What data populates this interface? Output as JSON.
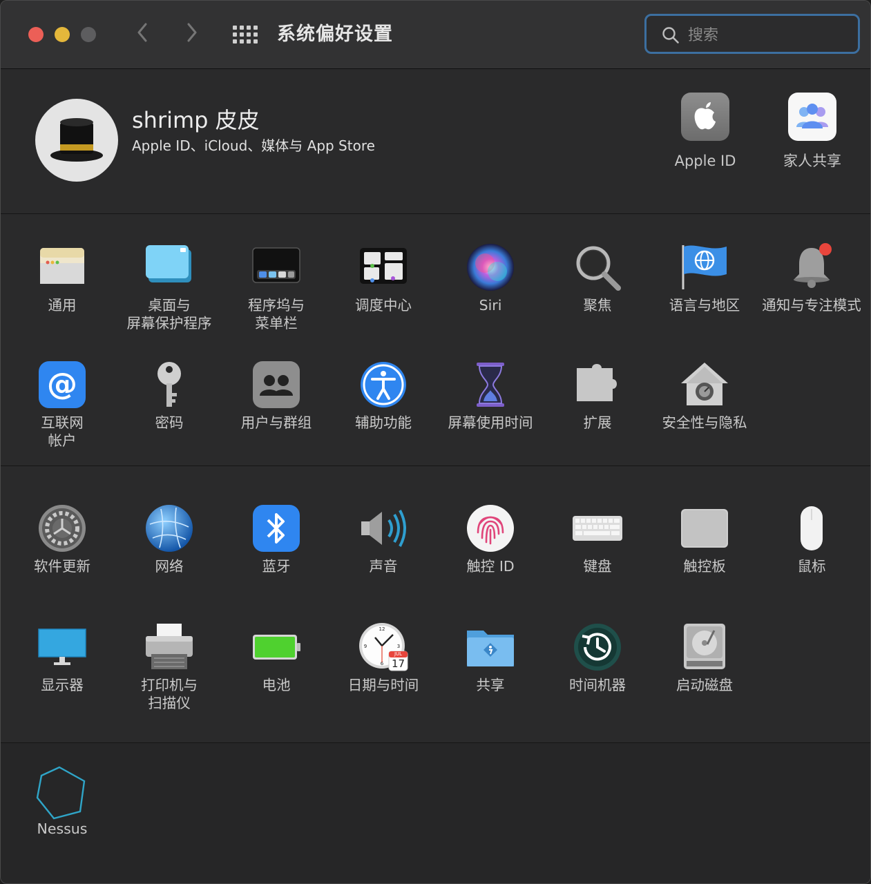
{
  "window": {
    "title": "系统偏好设置"
  },
  "search": {
    "placeholder": "搜索"
  },
  "account": {
    "name": "shrimp 皮皮",
    "subtitle": "Apple ID、iCloud、媒体与 App Store",
    "apple_id_label": "Apple ID",
    "family_label": "家人共享"
  },
  "row1": [
    {
      "label": "通用",
      "icon": "general-icon"
    },
    {
      "label": "桌面与\n屏幕保护程序",
      "icon": "desktop-icon"
    },
    {
      "label": "程序坞与\n菜单栏",
      "icon": "dock-icon"
    },
    {
      "label": "调度中心",
      "icon": "mission-control-icon"
    },
    {
      "label": "Siri",
      "icon": "siri-icon"
    },
    {
      "label": "聚焦",
      "icon": "spotlight-icon"
    },
    {
      "label": "语言与地区",
      "icon": "language-flag-icon"
    },
    {
      "label": "通知与专注模式",
      "icon": "notification-bell-icon"
    }
  ],
  "row2": [
    {
      "label": "互联网\n帐户",
      "icon": "at-sign-icon"
    },
    {
      "label": "密码",
      "icon": "key-icon"
    },
    {
      "label": "用户与群组",
      "icon": "users-icon"
    },
    {
      "label": "辅助功能",
      "icon": "accessibility-icon"
    },
    {
      "label": "屏幕使用时间",
      "icon": "hourglass-icon"
    },
    {
      "label": "扩展",
      "icon": "puzzle-icon"
    },
    {
      "label": "安全性与隐私",
      "icon": "house-lock-icon"
    }
  ],
  "row3": [
    {
      "label": "软件更新",
      "icon": "gear-icon"
    },
    {
      "label": "网络",
      "icon": "globe-network-icon"
    },
    {
      "label": "蓝牙",
      "icon": "bluetooth-icon"
    },
    {
      "label": "声音",
      "icon": "speaker-icon"
    },
    {
      "label": "触控 ID",
      "icon": "fingerprint-icon"
    },
    {
      "label": "键盘",
      "icon": "keyboard-icon"
    },
    {
      "label": "触控板",
      "icon": "trackpad-icon"
    },
    {
      "label": "鼠标",
      "icon": "mouse-icon"
    }
  ],
  "row4": [
    {
      "label": "显示器",
      "icon": "display-icon"
    },
    {
      "label": "打印机与\n扫描仪",
      "icon": "printer-icon"
    },
    {
      "label": "电池",
      "icon": "battery-icon"
    },
    {
      "label": "日期与时间",
      "icon": "clock-calendar-icon"
    },
    {
      "label": "共享",
      "icon": "sharing-folder-icon"
    },
    {
      "label": "时间机器",
      "icon": "time-machine-icon"
    },
    {
      "label": "启动磁盘",
      "icon": "disk-icon"
    }
  ],
  "other": [
    {
      "label": "Nessus",
      "icon": "hexagon-icon"
    }
  ],
  "calendar": {
    "month": "JUL",
    "day": "17"
  },
  "colors": {
    "accent": "#3c6fa0",
    "close": "#ec5f57",
    "minimize": "#e4b73b",
    "background": "#2a2a2b"
  }
}
